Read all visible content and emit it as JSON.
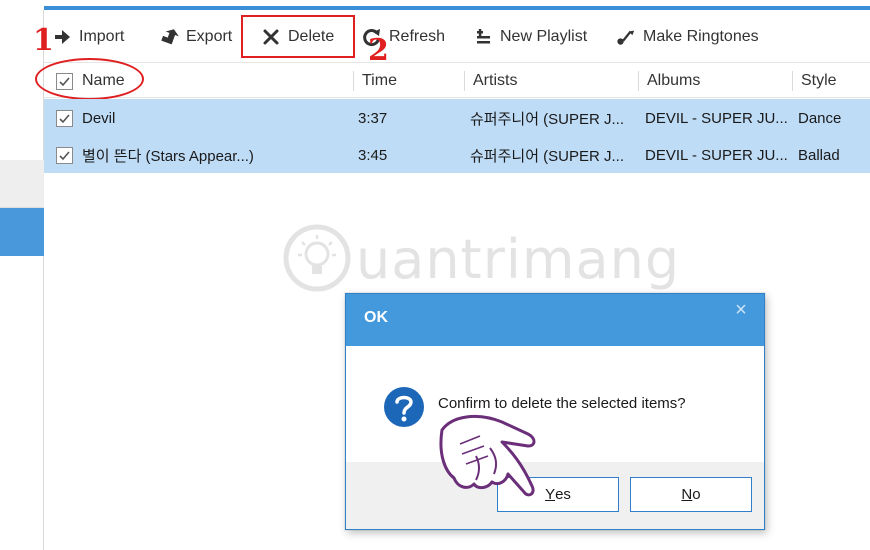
{
  "toolbar": {
    "import_label": "Import",
    "export_label": "Export",
    "delete_label": "Delete",
    "refresh_label": "Refresh",
    "new_playlist_label": "New Playlist",
    "make_ringtones_label": "Make Ringtones"
  },
  "annotations": {
    "step1": "1",
    "step2": "2"
  },
  "table": {
    "columns": [
      "Name",
      "Time",
      "Artists",
      "Albums",
      "Style"
    ],
    "header_checked": true,
    "rows": [
      {
        "checked": true,
        "name": "Devil",
        "time": "3:37",
        "artists": "슈퍼주니어 (SUPER J...",
        "albums": "DEVIL - SUPER JU...",
        "style": "Dance"
      },
      {
        "checked": true,
        "name": "별이 뜬다 (Stars Appear...)",
        "time": "3:45",
        "artists": "슈퍼주니어 (SUPER J...",
        "albums": "DEVIL - SUPER JU...",
        "style": "Ballad"
      }
    ]
  },
  "watermark": {
    "text": "uantrimang"
  },
  "dialog": {
    "title": "OK",
    "close_glyph": "×",
    "message": "Confirm to delete the selected items?",
    "yes_accel": "Y",
    "yes_rest": "es",
    "no_accel": "N",
    "no_rest": "o"
  },
  "colors": {
    "accent": "#3a8fd8",
    "selected_row": "#bfdcf7",
    "annotation_red": "#e02020",
    "dialog_title": "#4499dc"
  },
  "icons": [
    "import-icon",
    "export-icon",
    "delete-icon",
    "refresh-icon",
    "new-playlist-icon",
    "make-ringtones-icon",
    "question-icon",
    "close-icon",
    "pointing-hand-icon",
    "lightbulb-icon"
  ]
}
